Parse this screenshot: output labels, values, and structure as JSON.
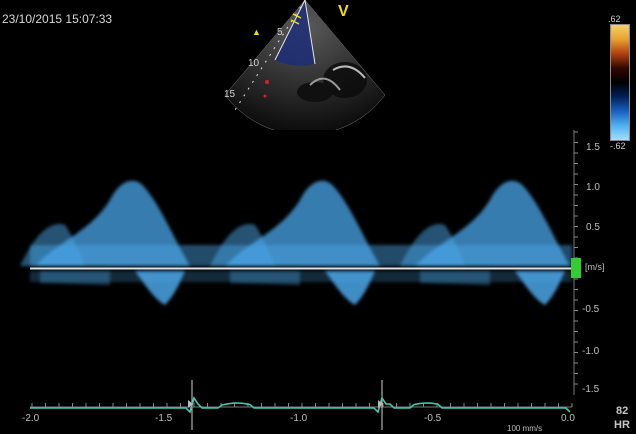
{
  "header": {
    "timestamp": "23/10/2015 15:07:33",
    "mode_label": "V",
    "marker": "▲"
  },
  "sector": {
    "depth_labels": [
      "5",
      "10",
      "15"
    ]
  },
  "color_scale": {
    "top": ".62",
    "bottom": "-.62",
    "colors": [
      "#f6d06a",
      "#e8a030",
      "#b04010",
      "#300800",
      "#000000",
      "#002058",
      "#1860c0",
      "#50b0f0",
      "#a0e0ff"
    ]
  },
  "velocity_axis": {
    "unit": "[m/s]",
    "ticks": [
      "1.5",
      "1.0",
      "0.5",
      "-0.5",
      "-1.0",
      "-1.5"
    ]
  },
  "time_axis": {
    "ticks": [
      "-2.0",
      "-1.5",
      "-1.0",
      "-0.5",
      "0.0"
    ],
    "sweep_speed": "100 mm/s"
  },
  "heart_rate": {
    "value": "82",
    "label": "HR"
  },
  "colors": {
    "doppler": "#4aa6e8",
    "ecg": "#40c8b0",
    "baseline": "#e0e0e0",
    "marker": "#33cc33",
    "text_yellow": "#f0e000"
  }
}
